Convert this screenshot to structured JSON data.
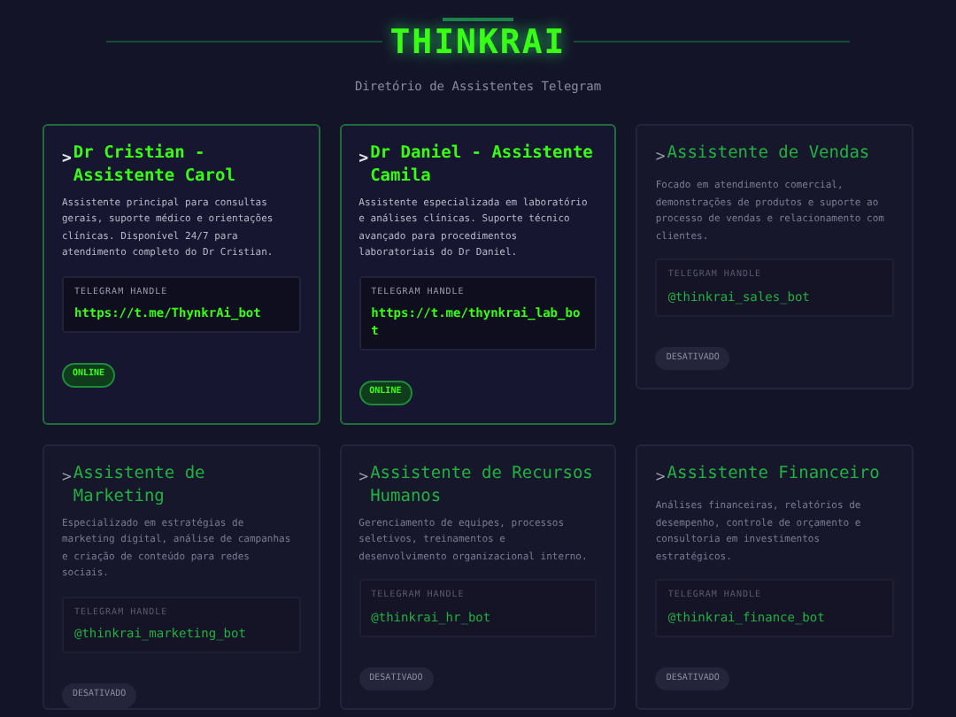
{
  "header": {
    "title": "THINKRAI",
    "subtitle": "Diretório de Assistentes Telegram"
  },
  "assistants": [
    {
      "prompt": ">",
      "name": "Dr Cristian - Assistente Carol",
      "description": "Assistente principal para consultas gerais, suporte médico e orientações clínicas. Disponível 24/7 para atendimento completo do Dr Cristian.",
      "handle_label": "TELEGRAM HANDLE",
      "handle": "https://t.me/ThynkrAi_bot",
      "active": true,
      "status": "ONLINE"
    },
    {
      "prompt": ">",
      "name": "Dr Daniel - Assistente Camila",
      "description": "Assistente especializada em laboratório e análises clínicas. Suporte técnico avançado para procedimentos laboratoriais do Dr Daniel.",
      "handle_label": "TELEGRAM HANDLE",
      "handle": "https://t.me/thynkrai_lab_bot",
      "active": true,
      "status": "ONLINE"
    },
    {
      "prompt": ">",
      "name": "Assistente de Vendas",
      "description": "Focado em atendimento comercial, demonstrações de produtos e suporte ao processo de vendas e relacionamento com clientes.",
      "handle_label": "TELEGRAM HANDLE",
      "handle": "@thinkrai_sales_bot",
      "active": false,
      "status": "DESATIVADO"
    },
    {
      "prompt": ">",
      "name": "Assistente de Marketing",
      "description": "Especializado em estratégias de marketing digital, análise de campanhas e criação de conteúdo para redes sociais.",
      "handle_label": "TELEGRAM HANDLE",
      "handle": "@thinkrai_marketing_bot",
      "active": false,
      "status": "DESATIVADO"
    },
    {
      "prompt": ">",
      "name": "Assistente de Recursos Humanos",
      "description": "Gerenciamento de equipes, processos seletivos, treinamentos e desenvolvimento organizacional interno.",
      "handle_label": "TELEGRAM HANDLE",
      "handle": "@thinkrai_hr_bot",
      "active": false,
      "status": "DESATIVADO"
    },
    {
      "prompt": ">",
      "name": "Assistente Financeiro",
      "description": "Análises financeiras, relatórios de desempenho, controle de orçamento e consultoria em investimentos estratégicos.",
      "handle_label": "TELEGRAM HANDLE",
      "handle": "@thinkrai_finance_bot",
      "active": false,
      "status": "DESATIVADO"
    }
  ]
}
